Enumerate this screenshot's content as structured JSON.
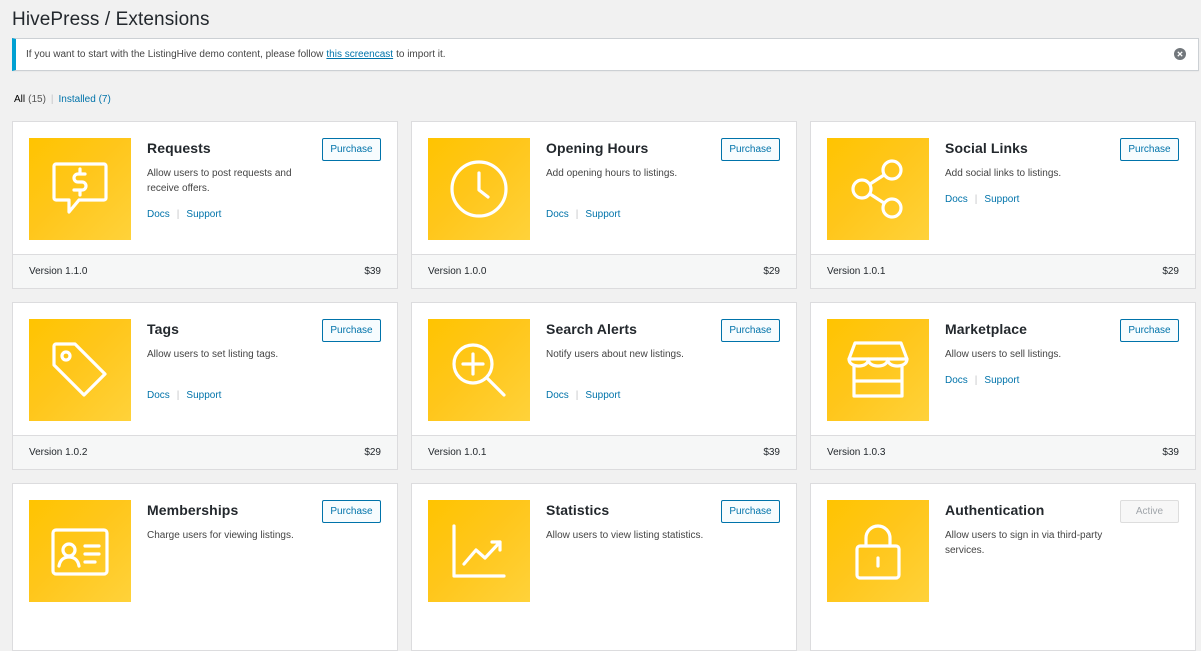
{
  "header": {
    "title": "HivePress / Extensions"
  },
  "notice": {
    "text_before": "If you want to start with the ListingHive demo content, please follow",
    "link_text": "this screencast",
    "text_after": "to import it.",
    "accent_color": "#00a0d2"
  },
  "filters": {
    "all_label": "All",
    "all_count": "(15)",
    "separator": "|",
    "installed_label": "Installed",
    "installed_count": "(7)"
  },
  "accent": {
    "thumb": "#ffc61a",
    "link": "#0073aa"
  },
  "extensions": [
    {
      "name": "Requests",
      "description": "Allow users to post requests and receive offers.",
      "docs": "Docs",
      "support": "Support",
      "button": "Purchase",
      "version": "Version 1.1.0",
      "price": "$39",
      "icon": "dollar-chat-icon"
    },
    {
      "name": "Opening Hours",
      "description": "Add opening hours to listings.",
      "docs": "Docs",
      "support": "Support",
      "button": "Purchase",
      "version": "Version 1.0.0",
      "price": "$29",
      "icon": "clock-icon"
    },
    {
      "name": "Social Links",
      "description": "Add social links to listings.",
      "docs": "Docs",
      "support": "Support",
      "button": "Purchase",
      "version": "Version 1.0.1",
      "price": "$29",
      "icon": "share-icon"
    },
    {
      "name": "Tags",
      "description": "Allow users to set listing tags.",
      "docs": "Docs",
      "support": "Support",
      "button": "Purchase",
      "version": "Version 1.0.2",
      "price": "$29",
      "icon": "tag-icon"
    },
    {
      "name": "Search Alerts",
      "description": "Notify users about new listings.",
      "docs": "Docs",
      "support": "Support",
      "button": "Purchase",
      "version": "Version 1.0.1",
      "price": "$39",
      "icon": "search-plus-icon"
    },
    {
      "name": "Marketplace",
      "description": "Allow users to sell listings.",
      "docs": "Docs",
      "support": "Support",
      "button": "Purchase",
      "version": "Version 1.0.3",
      "price": "$39",
      "icon": "store-icon"
    },
    {
      "name": "Memberships",
      "description": "Charge users for viewing listings.",
      "button": "Purchase",
      "icon": "id-card-icon"
    },
    {
      "name": "Statistics",
      "description": "Allow users to view listing statistics.",
      "button": "Purchase",
      "icon": "chart-icon"
    },
    {
      "name": "Authentication",
      "description": "Allow users to sign in via third-party services.",
      "button": "Active",
      "icon": "lock-icon"
    }
  ]
}
